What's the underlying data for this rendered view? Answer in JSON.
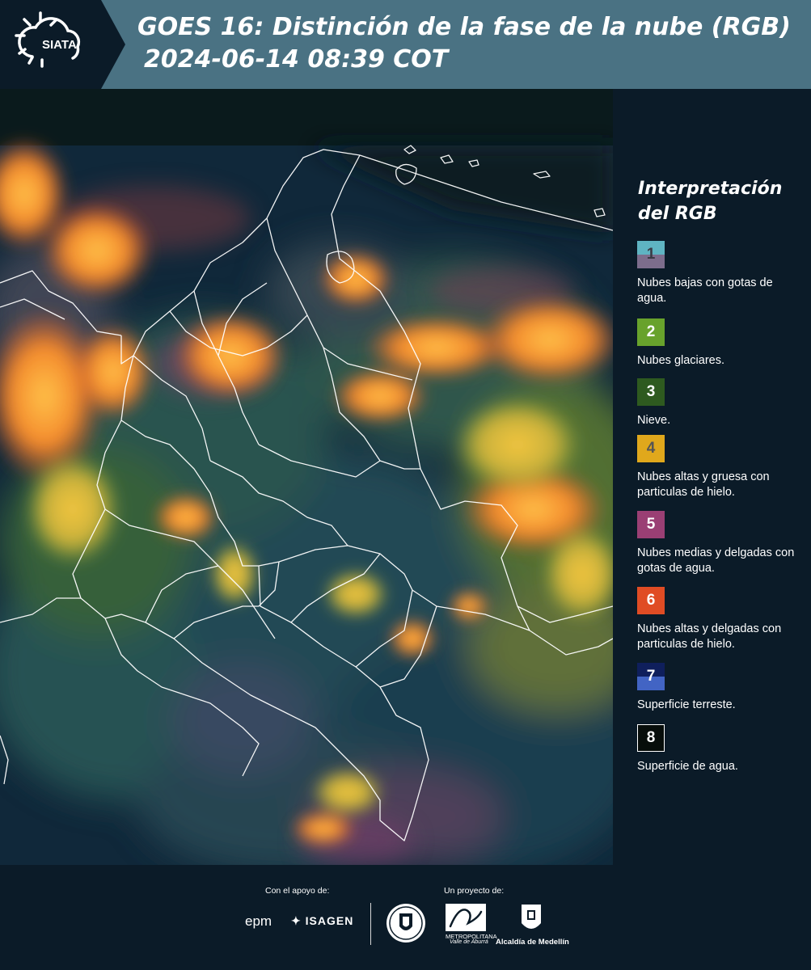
{
  "header": {
    "logo_text": "SIATA",
    "title_line1": "GOES 16: Distinción de la fase de la nube (RGB)",
    "title_line2": "2024-06-14 08:39 COT"
  },
  "legend": {
    "title": "Interpretación del RGB",
    "items": [
      {
        "number": "1",
        "label": "Nubes bajas con gotas de agua.",
        "color_top": "#5fb4c2",
        "color_bottom": "#7d6d8c"
      },
      {
        "number": "2",
        "label": "Nubes glaciares.",
        "color": "#68a22c"
      },
      {
        "number": "3",
        "label": "Nieve.",
        "color": "#2e5a1f"
      },
      {
        "number": "4",
        "label": "Nubes altas y gruesa con particulas de hielo.",
        "color": "#e0a81c"
      },
      {
        "number": "5",
        "label": "Nubes medias y delgadas con gotas de agua.",
        "color": "#9a3f74"
      },
      {
        "number": "6",
        "label": "Nubes altas y delgadas con particulas de hielo.",
        "color": "#e04c24"
      },
      {
        "number": "7",
        "label": "Superficie terreste.",
        "color_top": "#0f1f5c",
        "color_bottom": "#4264c4"
      },
      {
        "number": "8",
        "label": "Superficie de agua.",
        "color": "#070d0a"
      }
    ]
  },
  "footer": {
    "support_label": "Con el apoyo de:",
    "project_label": "Un proyecto de:",
    "sponsors": [
      "epm",
      "ISAGEN"
    ],
    "area_metropolitana": "METROPOLITANA",
    "area_sub": "Valle de Aburrá",
    "alcaldia": "Alcaldía de Medellín"
  }
}
